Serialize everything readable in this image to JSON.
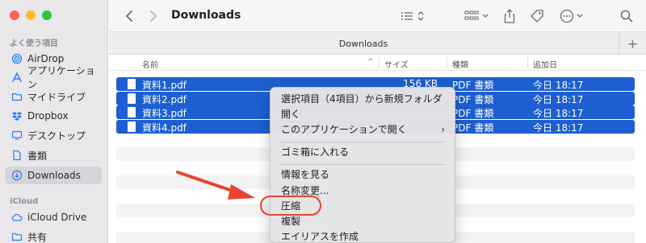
{
  "sidebar": {
    "favorites_title": "よく使う項目",
    "items": [
      {
        "label": "AirDrop",
        "icon": "airdrop-icon"
      },
      {
        "label": "アプリケーション",
        "icon": "applications-icon"
      },
      {
        "label": "マイドライブ",
        "icon": "folder-icon"
      },
      {
        "label": "Dropbox",
        "icon": "dropbox-icon"
      },
      {
        "label": "デスクトップ",
        "icon": "desktop-icon"
      },
      {
        "label": "書類",
        "icon": "document-icon"
      },
      {
        "label": "Downloads",
        "icon": "download-icon"
      }
    ],
    "icloud_title": "iCloud",
    "icloud_items": [
      {
        "label": "iCloud Drive",
        "icon": "cloud-icon"
      },
      {
        "label": "共有",
        "icon": "shared-folder-icon"
      }
    ]
  },
  "toolbar": {
    "title": "Downloads"
  },
  "tabbar": {
    "tab_label": "Downloads",
    "new_tab": "+"
  },
  "columns": {
    "name": "名前",
    "size": "サイズ",
    "kind": "種類",
    "date": "追加日"
  },
  "files": [
    {
      "name": "資料1.pdf",
      "size": "156 KB",
      "kind": "PDF 書類",
      "date": "今日 18:17"
    },
    {
      "name": "資料2.pdf",
      "size": "",
      "kind": "PDF 書類",
      "date": "今日 18:17"
    },
    {
      "name": "資料3.pdf",
      "size": "",
      "kind": "PDF 書類",
      "date": "今日 18:17"
    },
    {
      "name": "資料4.pdf",
      "size": "",
      "kind": "PDF 書類",
      "date": "今日 18:17"
    }
  ],
  "context_menu": {
    "items": [
      "選択項目（4項目）から新規フォルダ",
      "開く",
      "このアプリケーションで開く",
      "ゴミ箱に入れる",
      "情報を見る",
      "名称変更...",
      "圧縮",
      "複製",
      "エイリアスを作成"
    ]
  },
  "colors": {
    "selection": "#1d5fd0",
    "accent": "#2e7cf6",
    "highlight_ring": "#e8442d"
  }
}
